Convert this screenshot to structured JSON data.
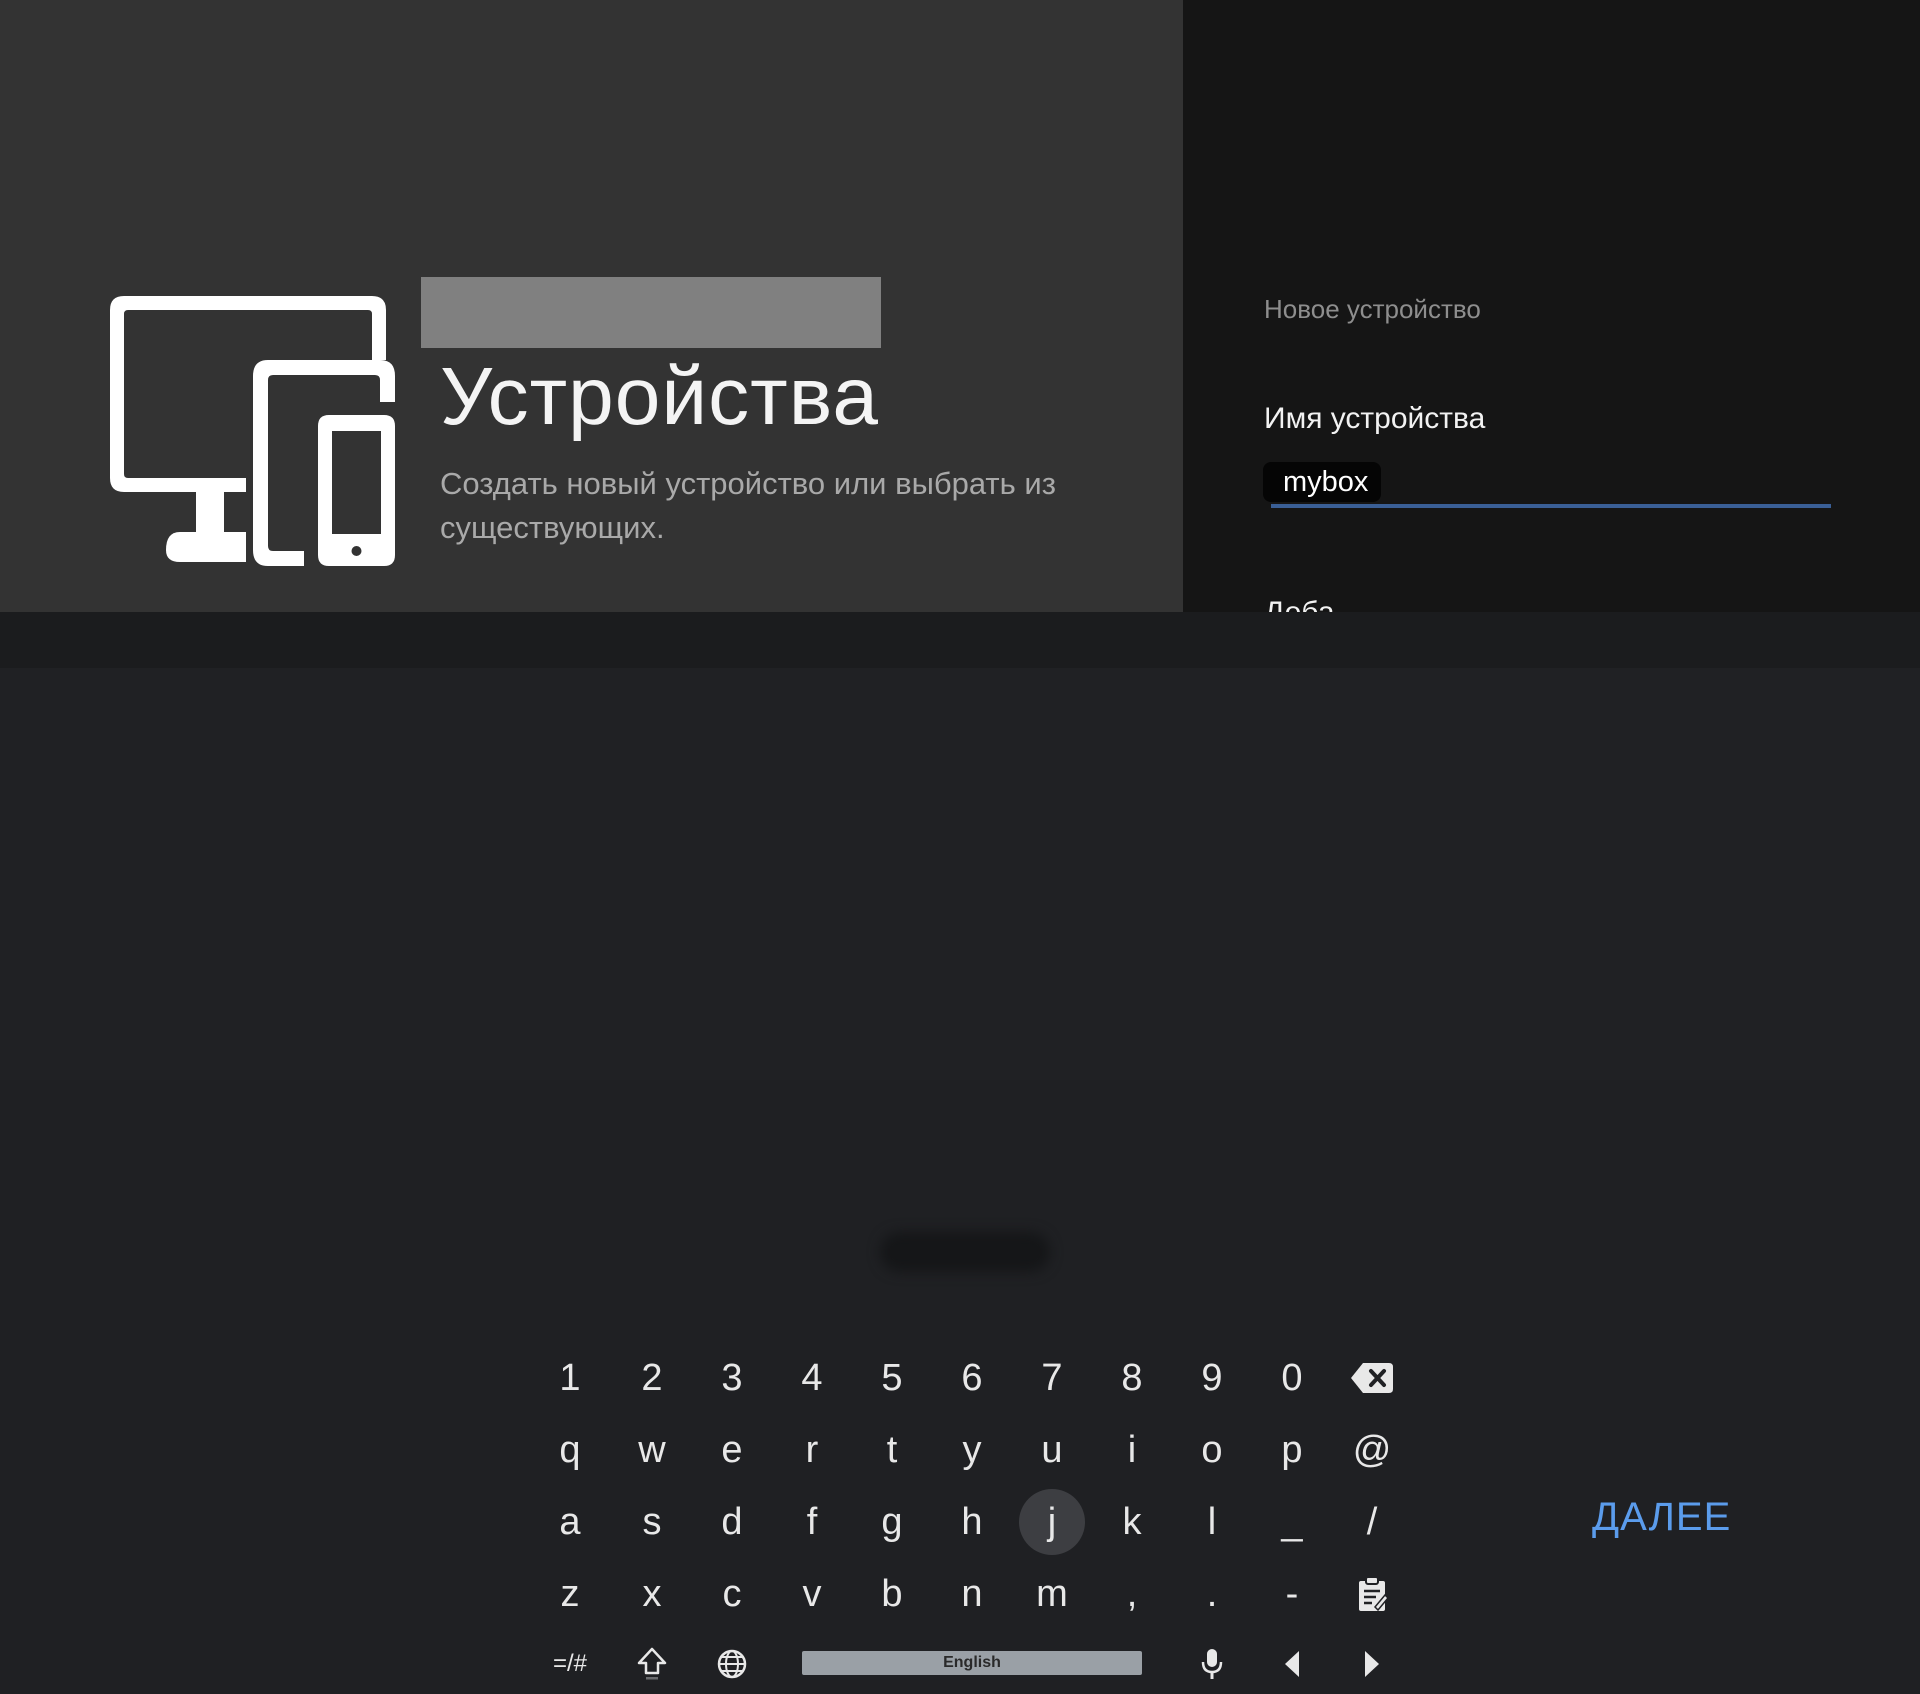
{
  "section": {
    "title": "Устройства",
    "description": "Создать новый устройство или выбрать из существующих.",
    "icon": "devices-icon"
  },
  "form": {
    "breadcrumb": "Новое устройство",
    "field_label": "Имя устройства",
    "field_value": "mybox",
    "next_item_partial": "Доба"
  },
  "keyboard": {
    "rows": [
      [
        "1",
        "2",
        "3",
        "4",
        "5",
        "6",
        "7",
        "8",
        "9",
        "0"
      ],
      [
        "q",
        "w",
        "e",
        "r",
        "t",
        "y",
        "u",
        "i",
        "o",
        "p",
        "@"
      ],
      [
        "a",
        "s",
        "d",
        "f",
        "g",
        "h",
        "j",
        "k",
        "l",
        "_",
        "/"
      ],
      [
        "z",
        "x",
        "c",
        "v",
        "b",
        "n",
        "m",
        ",",
        ".",
        "-"
      ]
    ],
    "focused_key": "j",
    "symbols_label": "=/#",
    "language_label": "English",
    "action_label": "ДАЛЕЕ",
    "icons": {
      "backspace": "backspace-icon",
      "clipboard": "clipboard-icon",
      "shift": "shift-icon",
      "language": "globe-icon",
      "voice": "microphone-icon",
      "cursor_left": "arrow-left-icon",
      "cursor_right": "arrow-right-icon"
    }
  },
  "colors": {
    "accent": "#5b9cec",
    "input_underline": "#3a5f96",
    "left_panel": "#333333",
    "right_panel": "#151515",
    "keyboard_bg": "#202124"
  }
}
